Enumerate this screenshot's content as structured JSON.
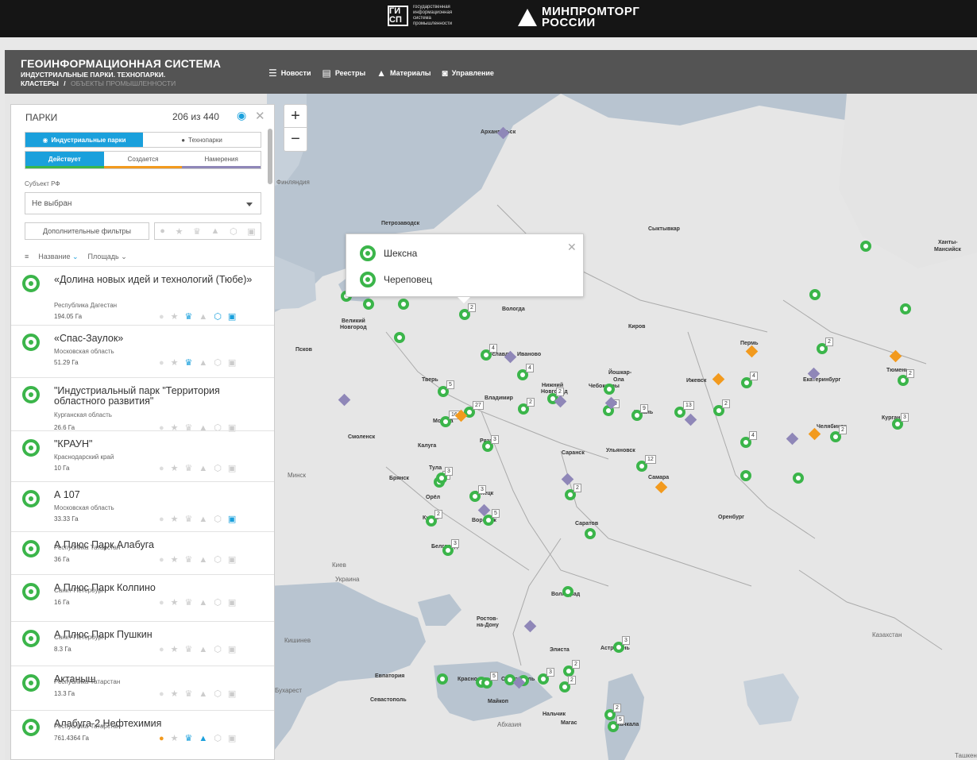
{
  "topbar": {
    "gisp_logo": "ГИ СП",
    "gisp_text": "государственная информационная система промышленности",
    "ministry_line1": "МИНПРОМТОРГ",
    "ministry_line2": "РОССИИ"
  },
  "header": {
    "title": "ГЕОИНФОРМАЦИОННАЯ СИСТЕМА",
    "subtitle_line": "ИНДУСТРИАЛЬНЫЕ ПАРКИ. ТЕХНОПАРКИ.",
    "crumb_active": "КЛАСТЕРЫ",
    "crumb_sep": "/",
    "crumb_dim": "ОБЪЕКТЫ ПРОМЫШЛЕННОСТИ",
    "nav": [
      {
        "label": "Новости",
        "icon": "list-icon"
      },
      {
        "label": "Реестры",
        "icon": "registry-icon"
      },
      {
        "label": "Материалы",
        "icon": "materials-icon"
      },
      {
        "label": "Управление",
        "icon": "gamepad-icon"
      }
    ]
  },
  "panel": {
    "title": "ПАРКИ",
    "count": "206 из 440",
    "tabs": [
      "Индустриальные парки",
      "Технопарки"
    ],
    "status": [
      "Действует",
      "Создается",
      "Намерения"
    ],
    "subject_label": "Субъект РФ",
    "subject_value": "Не выбран",
    "more_filters": "Дополнительные фильтры",
    "sort_name": "Название",
    "sort_area": "Площадь"
  },
  "items": [
    {
      "name": "«Долина новых идей и технологий (Тюбе)»",
      "region": "Республика Дагестан",
      "area": "194.05 Га"
    },
    {
      "name": "«Спас-Заулок»",
      "region": "Московская область",
      "area": "51.29 Га"
    },
    {
      "name": "\"Индустриальный парк \"Территория областного развития\"",
      "region": "Курганская область",
      "area": "26.6 Га"
    },
    {
      "name": "\"КРАУН\"",
      "region": "Краснодарский край",
      "area": "10 Га"
    },
    {
      "name": "А 107",
      "region": "Московская область",
      "area": "33.33 Га"
    },
    {
      "name": "А Плюс Парк Алабуга",
      "region": "Республика Татарстан",
      "area": "36 Га"
    },
    {
      "name": "А Плюс Парк Колпино",
      "region": "Санкт-Петербург",
      "area": "16 Га"
    },
    {
      "name": "А Плюс Парк Пушкин",
      "region": "Санкт-Петербург",
      "area": "8.3 Га"
    },
    {
      "name": "Актаныш",
      "region": "Республика Татарстан",
      "area": "13.3 Га"
    },
    {
      "name": "Алабуга-2.Нефтехимия",
      "region": "Республика Татарстан",
      "area": "761.4364 Га"
    }
  ],
  "popup": {
    "items": [
      "Шексна",
      "Череповец"
    ]
  },
  "map": {
    "cities": [
      {
        "t": "Архангельск"
      },
      {
        "t": "Петрозаводск"
      },
      {
        "t": "Сыктывкар"
      },
      {
        "t": "Ханты-"
      },
      {
        "t": "Мансийск"
      },
      {
        "t": "Вологда"
      },
      {
        "t": "Великий"
      },
      {
        "t": "Новгород"
      },
      {
        "t": "Киров"
      },
      {
        "t": "Псков"
      },
      {
        "t": "Ярославль"
      },
      {
        "t": "Иваново"
      },
      {
        "t": "Тверь"
      },
      {
        "t": "Йошкар-"
      },
      {
        "t": "Ола"
      },
      {
        "t": "Чебоксары"
      },
      {
        "t": "Нижний"
      },
      {
        "t": "Новгород"
      },
      {
        "t": "Пермь"
      },
      {
        "t": "Екатеринбург"
      },
      {
        "t": "Тюмень"
      },
      {
        "t": "Ижевск"
      },
      {
        "t": "Владимир"
      },
      {
        "t": "Москва"
      },
      {
        "t": "Казань"
      },
      {
        "t": "Смоленск"
      },
      {
        "t": "Калуга"
      },
      {
        "t": "Рязань"
      },
      {
        "t": "Челябинск"
      },
      {
        "t": "Курган"
      },
      {
        "t": "Тула"
      },
      {
        "t": "Саранск"
      },
      {
        "t": "Ульяновск"
      },
      {
        "t": "Брянск"
      },
      {
        "t": "Самара"
      },
      {
        "t": "Орёл"
      },
      {
        "t": "Липецк"
      },
      {
        "t": "Курск"
      },
      {
        "t": "Воронеж"
      },
      {
        "t": "Саратов"
      },
      {
        "t": "Оренбург"
      },
      {
        "t": "Белгород"
      },
      {
        "t": "Волгоград"
      },
      {
        "t": "Ростов-"
      },
      {
        "t": "на-Дону"
      },
      {
        "t": "Элиста"
      },
      {
        "t": "Астрахань"
      },
      {
        "t": "Евпатория"
      },
      {
        "t": "Краснодар"
      },
      {
        "t": "Ставрополь"
      },
      {
        "t": "Севастополь"
      },
      {
        "t": "Майкоп"
      },
      {
        "t": "Нальчик"
      },
      {
        "t": "Магас"
      },
      {
        "t": "Махачкала"
      }
    ],
    "countries": [
      {
        "t": "Финляндия"
      },
      {
        "t": "Минск"
      },
      {
        "t": "Киев"
      },
      {
        "t": "Украина"
      },
      {
        "t": "Кишинев"
      },
      {
        "t": "Казахстан"
      },
      {
        "t": "Абхазия"
      },
      {
        "t": "Бухарест"
      },
      {
        "t": "Ташкент"
      }
    ],
    "markers": [
      {
        "c": ""
      },
      {
        "c": ""
      },
      {
        "c": ""
      },
      {
        "c": ""
      },
      {
        "c": ""
      },
      {
        "c": "2"
      },
      {
        "c": ""
      },
      {
        "c": ""
      },
      {
        "c": "4"
      },
      {
        "c": "4"
      },
      {
        "c": "5"
      },
      {
        "c": "27"
      },
      {
        "c": "16"
      },
      {
        "c": "2"
      },
      {
        "c": "2"
      },
      {
        "c": ""
      },
      {
        "c": "2"
      },
      {
        "c": "9"
      },
      {
        "c": "13"
      },
      {
        "c": "4"
      },
      {
        "c": "2"
      },
      {
        "c": "2"
      },
      {
        "c": "2"
      },
      {
        "c": "3"
      },
      {
        "c": "3"
      },
      {
        "c": "2"
      },
      {
        "c": "3"
      },
      {
        "c": "3"
      },
      {
        "c": "5"
      },
      {
        "c": "2"
      },
      {
        "c": "12"
      },
      {
        "c": "2"
      },
      {
        "c": "4"
      },
      {
        "c": "2"
      },
      {
        "c": "3"
      },
      {
        "c": ""
      },
      {
        "c": ""
      },
      {
        "c": ""
      },
      {
        "c": "3"
      },
      {
        "c": ""
      },
      {
        "c": "2"
      },
      {
        "c": ""
      },
      {
        "c": ""
      },
      {
        "c": "5"
      },
      {
        "c": "3"
      },
      {
        "c": "2"
      },
      {
        "c": "5"
      },
      {
        "c": "2"
      },
      {
        "c": ""
      },
      {
        "c": ""
      }
    ]
  }
}
